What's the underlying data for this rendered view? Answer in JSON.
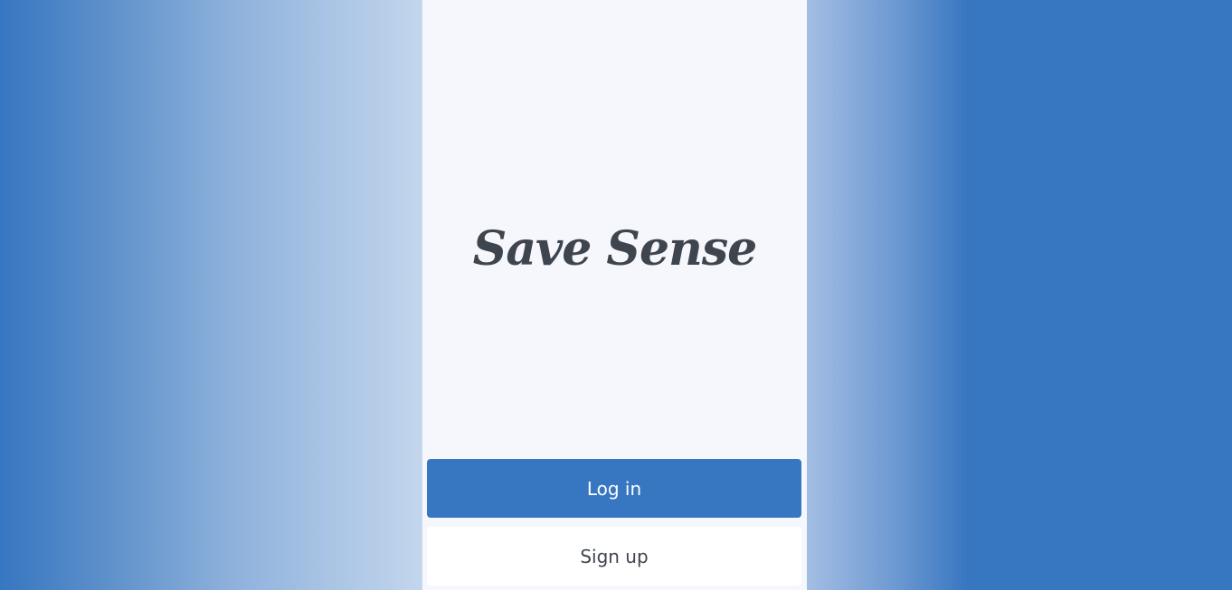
{
  "app": {
    "brand_name": "Save Sense"
  },
  "actions": {
    "login_label": "Log in",
    "signup_label": "Sign up"
  },
  "colors": {
    "accent": "#3776c1",
    "panel_background": "#f6f7fd",
    "text_dark": "#3f454e"
  }
}
